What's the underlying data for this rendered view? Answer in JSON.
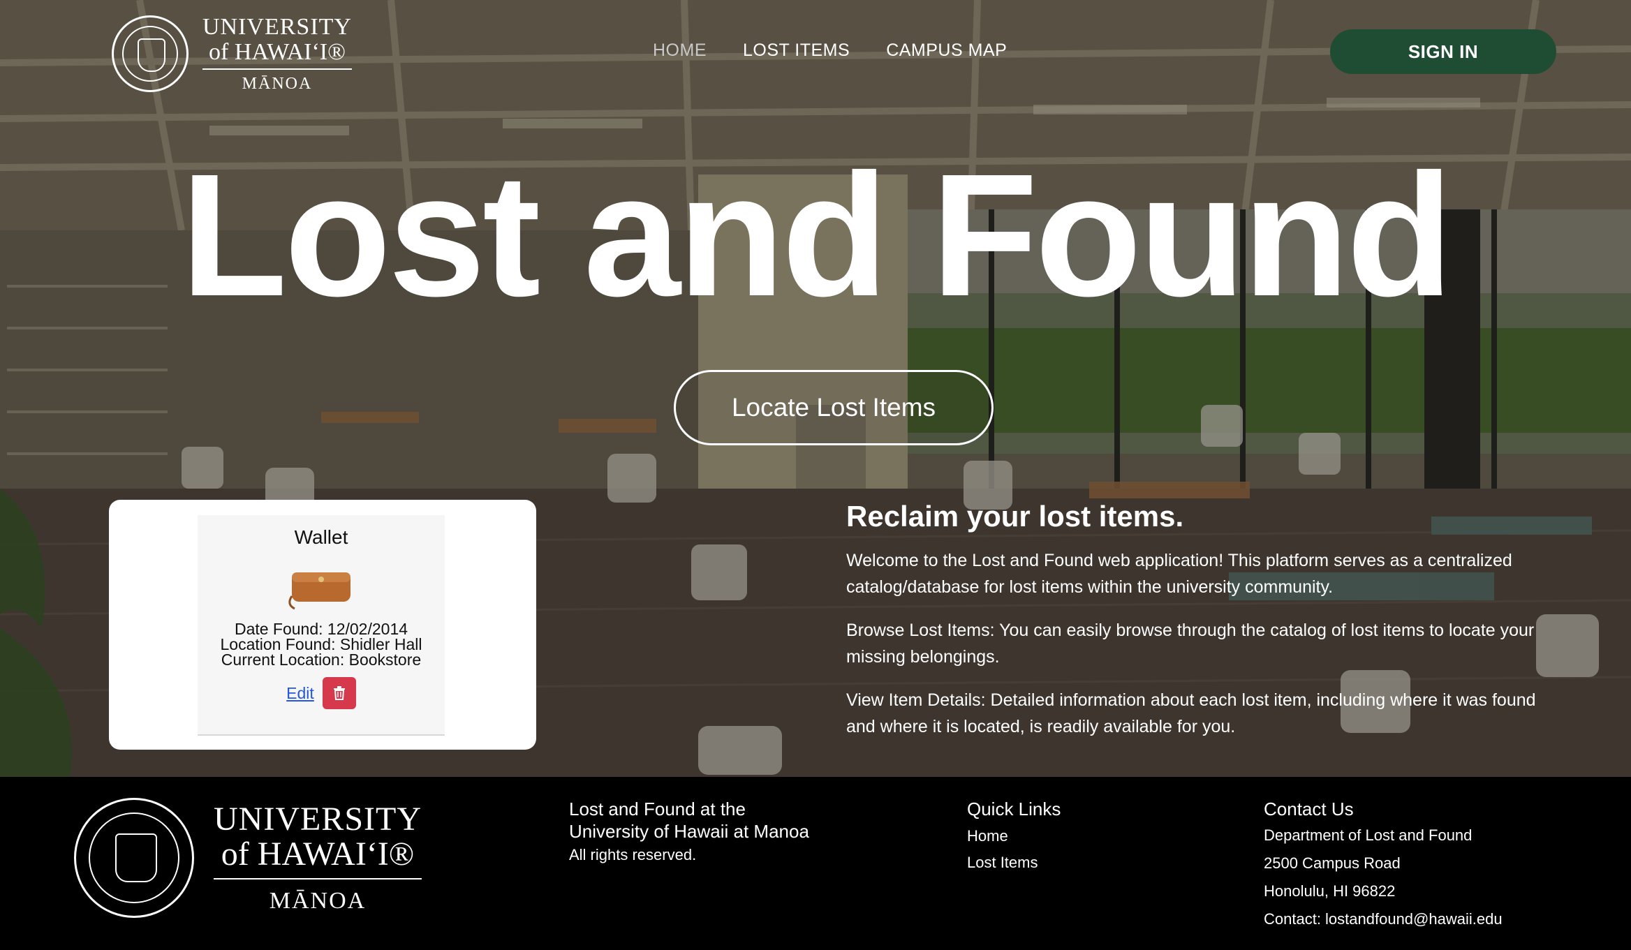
{
  "header": {
    "logo": {
      "line1": "UNIVERSITY",
      "line2": "of HAWAIʻI®",
      "line3": "MĀNOA"
    },
    "nav": [
      {
        "label": "HOME",
        "active": true
      },
      {
        "label": "LOST ITEMS",
        "active": false
      },
      {
        "label": "CAMPUS MAP",
        "active": false
      }
    ],
    "signin_label": "SIGN IN"
  },
  "hero": {
    "title": "Lost and Found",
    "cta_label": "Locate Lost Items"
  },
  "item_card": {
    "name": "Wallet",
    "date_found": "Date Found: 12/02/2014",
    "location_found": "Location Found: Shidler Hall",
    "current_location": "Current Location: Bookstore",
    "edit_label": "Edit",
    "delete_icon": "trash-icon"
  },
  "intro": {
    "heading": "Reclaim your lost items.",
    "paragraphs": [
      "Welcome to the Lost and Found web application! This platform serves as a centralized catalog/database for lost items within the university community.",
      "Browse Lost Items: You can easily browse through the catalog of lost items to locate your missing belongings.",
      "View Item Details: Detailed information about each lost item, including where it was found and where it is located, is readily available for you."
    ]
  },
  "footer": {
    "logo": {
      "line1": "UNIVERSITY",
      "line2": "of HAWAIʻI®",
      "line3": "MĀNOA"
    },
    "about": {
      "title_line1": "Lost and Found at the",
      "title_line2": "University of Hawaii at Manoa",
      "rights": "All rights reserved."
    },
    "quick_links": {
      "title": "Quick Links",
      "links": [
        "Home",
        "Lost Items"
      ]
    },
    "contact": {
      "title": "Contact Us",
      "lines": [
        "Department of Lost and Found",
        "2500 Campus Road",
        "Honolulu, HI 96822",
        "Contact: lostandfound@hawaii.edu"
      ]
    }
  },
  "colors": {
    "signin_bg": "#1e4d34",
    "delete_bg": "#d6394b",
    "edit_link": "#2256e6",
    "footer_bg": "#000000"
  }
}
